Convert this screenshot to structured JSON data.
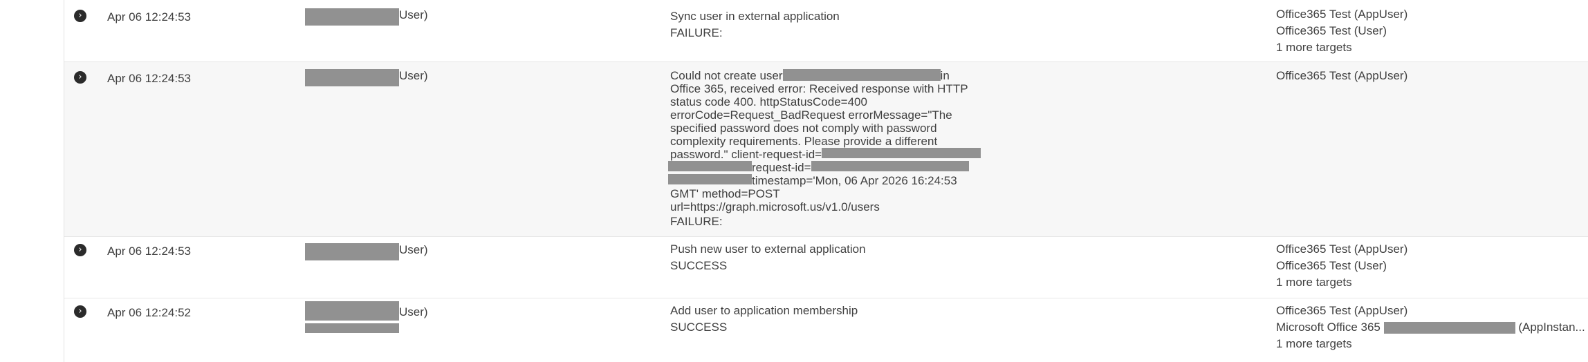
{
  "rows": [
    {
      "time": "Apr 06 12:24:53",
      "actor_suffix": "User)",
      "event_title": "Sync user in external application",
      "outcome": "FAILURE:",
      "targets": [
        "Office365 Test  (AppUser)",
        "Office365 Test  (User)"
      ],
      "more_targets": "1 more targets"
    },
    {
      "time": "Apr 06 12:24:53",
      "actor_suffix": "User)",
      "error_parts": {
        "l1a": "Could not create user",
        "l1b": "in",
        "l2": "Office 365, received error: Received response with HTTP",
        "l3": "status code 400. httpStatusCode=400",
        "l4": "errorCode=Request_BadRequest errorMessage=\"The",
        "l5": "specified password does not comply with password",
        "l6": "complexity requirements. Please provide a different",
        "l7": "password.\" client-request-id=",
        "l8": "request-id=",
        "l9": "timestamp='Mon, 06 Apr 2026 16:24:53",
        "l10": "GMT' method=POST",
        "l11": "url=https://graph.microsoft.us/v1.0/users"
      },
      "outcome": "FAILURE:",
      "targets": [
        "Office365 Test  (AppUser)"
      ]
    },
    {
      "time": "Apr 06 12:24:53",
      "actor_suffix": "User)",
      "event_title": "Push new user to external application",
      "outcome": "SUCCESS",
      "targets": [
        "Office365 Test  (AppUser)",
        "Office365 Test  (User)"
      ],
      "more_targets": "1 more targets"
    },
    {
      "time": "Apr 06 12:24:52",
      "actor_suffix": "User)",
      "event_title": "Add user to application membership",
      "outcome": "SUCCESS",
      "targets": [
        "Office365 Test  (AppUser)"
      ],
      "target2_prefix": "Microsoft Office 365",
      "target2_suffix": "(AppInstan...",
      "more_targets": "1 more targets"
    }
  ],
  "icons": {
    "expand": "chevron-right-circle-icon"
  },
  "colors": {
    "redaction": "#919191",
    "row_alt_bg": "#f7f7f7"
  }
}
